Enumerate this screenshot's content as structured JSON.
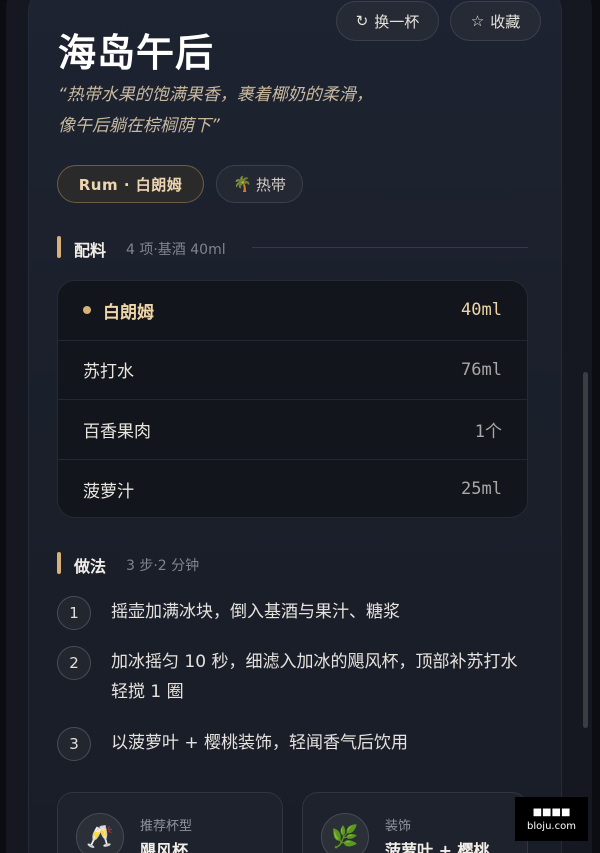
{
  "header": {
    "swap_icon": "refresh-icon",
    "swap_label": "换一杯",
    "fav_icon": "star-icon",
    "fav_label": "收藏"
  },
  "drink": {
    "title": "海岛午后",
    "quote": "“热带水果的饱满果香，裹着椰奶的柔滑，像午后躺在棕榈荫下”",
    "tags": [
      {
        "label": "Rum · 白朗姆"
      },
      {
        "icon": "🌴",
        "label": "热带"
      }
    ]
  },
  "ingredients": {
    "title": "配料",
    "subtitle": "4 项·基酒 40ml",
    "items": [
      {
        "name": "白朗姆",
        "amount": "40ml",
        "is_base": true
      },
      {
        "name": "苏打水",
        "amount": "76ml"
      },
      {
        "name": "百香果肉",
        "amount": "1个"
      },
      {
        "name": "菠萝汁",
        "amount": "25ml"
      }
    ]
  },
  "method": {
    "title": "做法",
    "subtitle": "3 步·2 分钟",
    "steps": [
      {
        "num": "1",
        "text": "摇壶加满冰块，倒入基酒与果汁、糖浆"
      },
      {
        "num": "2",
        "text": "加冰摇匀 10 秒，细滤入加冰的飓风杯，顶部补苏打水轻搅 1 圈"
      },
      {
        "num": "3",
        "text": "以菠萝叶 + 樱桃装饰，轻闻香气后饮用"
      }
    ]
  },
  "info": {
    "glass_icon": "🥂",
    "glass_label": "推荐杯型",
    "glass_value": "飓风杯",
    "garnish_icon": "🌿",
    "garnish_label": "装饰",
    "garnish_value": "菠萝叶 + 樱桃"
  },
  "watermark": {
    "line1": "■■■■",
    "line2": "bloju.com"
  },
  "colors": {
    "accent": "#d7b07a",
    "base_text": "#f0d5a8",
    "card_bg": "#1d2330"
  }
}
